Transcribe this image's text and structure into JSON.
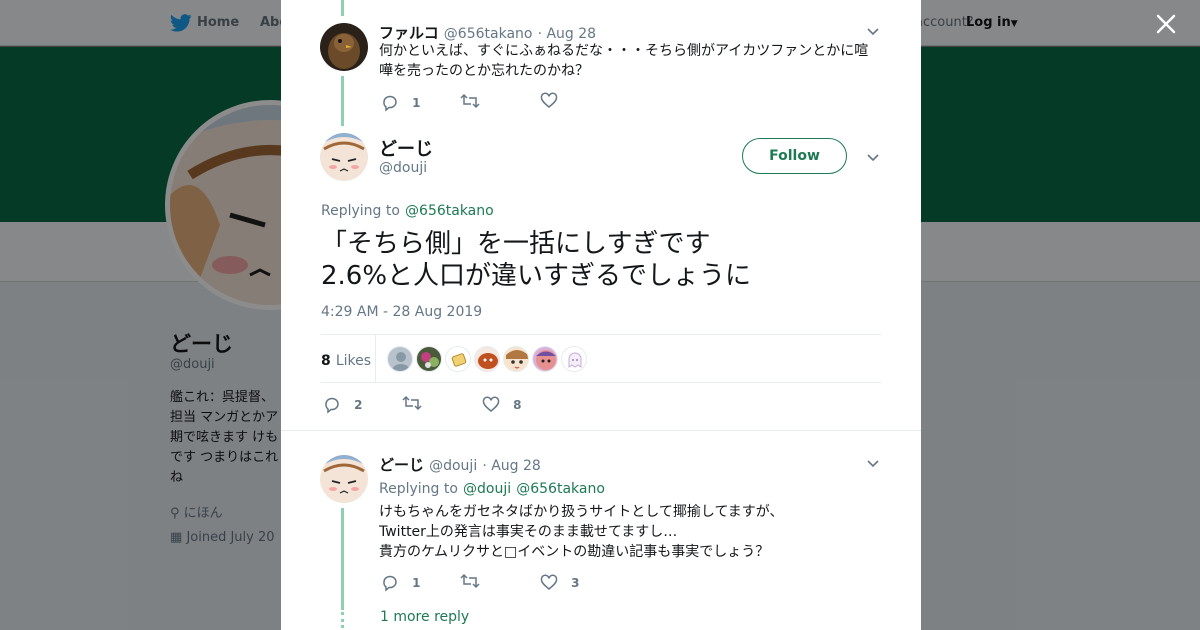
{
  "background": {
    "nav": {
      "home_label": "Home",
      "about_label": "Abo",
      "account_prompt": "account?",
      "login_label": "Log in"
    },
    "profile": {
      "name": "どーじ",
      "handle": "@douji",
      "bio": "艦これ：呉提督、\n担当 マンガとかア\n期で呟きます けも\nです つまりはこれ\nね",
      "location": "にほん",
      "joined": "Joined July 20"
    }
  },
  "parent_tweet": {
    "display_name": "ファルコ",
    "handle": "@656takano",
    "date": "· Aug 28",
    "text": "何かといえば、すぐにふぁねるだな・・・そちら側がアイカツファンとかに喧嘩を売ったのとか忘れたのかね？",
    "reply_count": "1",
    "retweet_count": "",
    "like_count": ""
  },
  "main_tweet": {
    "display_name": "どーじ",
    "handle": "@douji",
    "follow_label": "Follow",
    "replying_prefix": "Replying to",
    "replying_to": "@656takano",
    "text": "「そちら側」を一括にしすぎです\n2.6%と人口が違いすぎるでしょうに",
    "timestamp": "4:29 AM - 28 Aug 2019",
    "likes_count": "8",
    "likes_label": "Likes",
    "reply_count": "2",
    "retweet_count": "",
    "like_count": "8"
  },
  "reply_tweet": {
    "display_name": "どーじ",
    "handle": "@douji",
    "date": "· Aug 28",
    "replying_prefix": "Replying to",
    "replying_to_1": "@douji",
    "replying_to_2": "@656takano",
    "text_line1": "けもちゃんをガセネタばかり扱うサイトとして揶揄してますが、",
    "text_line2": "Twitter上の発言は事実そのまま載せてますし…",
    "text_line3": "貴方のケムリクサと□イベントの勘違い記事も事実でしょう？",
    "reply_count": "1",
    "retweet_count": "",
    "like_count": "3",
    "more_replies": "1 more reply"
  },
  "colors": {
    "accent": "#1d7a53",
    "banner": "#0a6b47",
    "thread_line": "#8ed1b0",
    "muted_text": "#657786"
  }
}
